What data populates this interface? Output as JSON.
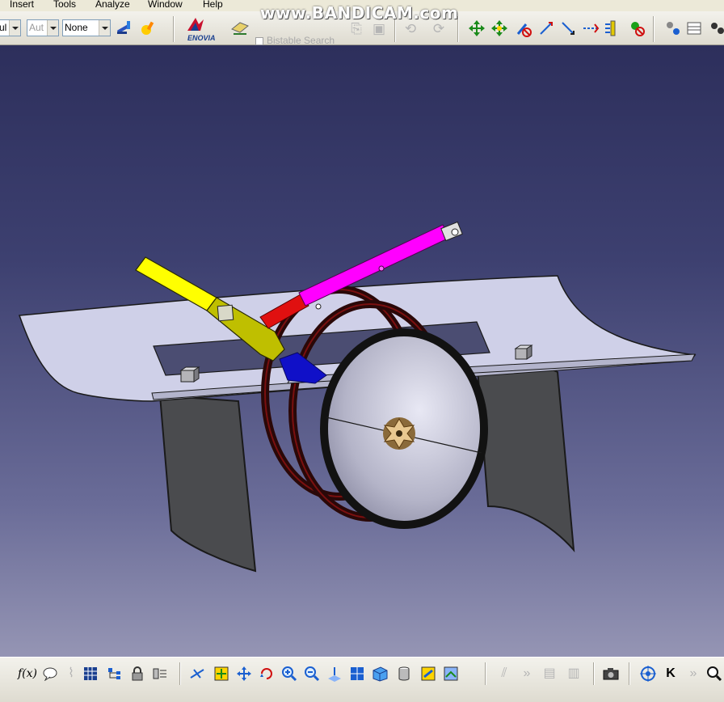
{
  "menu": {
    "items": [
      "Insert",
      "Tools",
      "Analyze",
      "Window",
      "Help"
    ]
  },
  "toolbar_top": {
    "combo_style": "ul",
    "combo_auto": "Aut",
    "combo_none": "None",
    "enovia_label": "ENOVIA",
    "grayed_option": "Bistable Search"
  },
  "watermark": "www.BANDICAM.com",
  "icons": {
    "top": [
      "paint-brush-icon",
      "graphic-properties-icon",
      "enovia-logo",
      "catalog-icon",
      "checkbox",
      "compass-icon",
      "snapshot-icon",
      "manipulation-icon",
      "move-icon",
      "snap-icon",
      "explode-icon",
      "clash-icon",
      "sectioning-icon",
      "distance-icon",
      "measure-icon",
      "annotation-icon",
      "wear-icon",
      "settings-icon",
      "table-icon"
    ],
    "bottom": [
      "formula-icon",
      "comment-icon",
      "clip-icon",
      "grid-icon",
      "tree-icon",
      "lock-icon",
      "scene-icon",
      "fly-icon",
      "fit-all-icon",
      "pan-icon",
      "rotate-icon",
      "zoom-in-icon",
      "zoom-out-icon",
      "normal-view-icon",
      "iso-view-icon",
      "cube-view-icon",
      "render-style-icon",
      "hide-show-icon",
      "swap-visible-icon",
      "undo-dim-icon",
      "redo-dim-icon",
      "layer-icon",
      "camera-icon",
      "target-icon",
      "rewind-icon",
      "forward-icon",
      "magnifier-icon"
    ]
  },
  "colors": {
    "viewport_top": "#2d2f5c",
    "viewport_bottom": "#9595b4",
    "hydraulic_rod": "#ff00ff",
    "actuator_red": "#e01010",
    "lever_yellow": "#ffff00",
    "lever_olive": "#bfbf00",
    "block_blue": "#1010c8",
    "plate": "#cfd0e8",
    "side_panels": "#4a4b4e"
  }
}
